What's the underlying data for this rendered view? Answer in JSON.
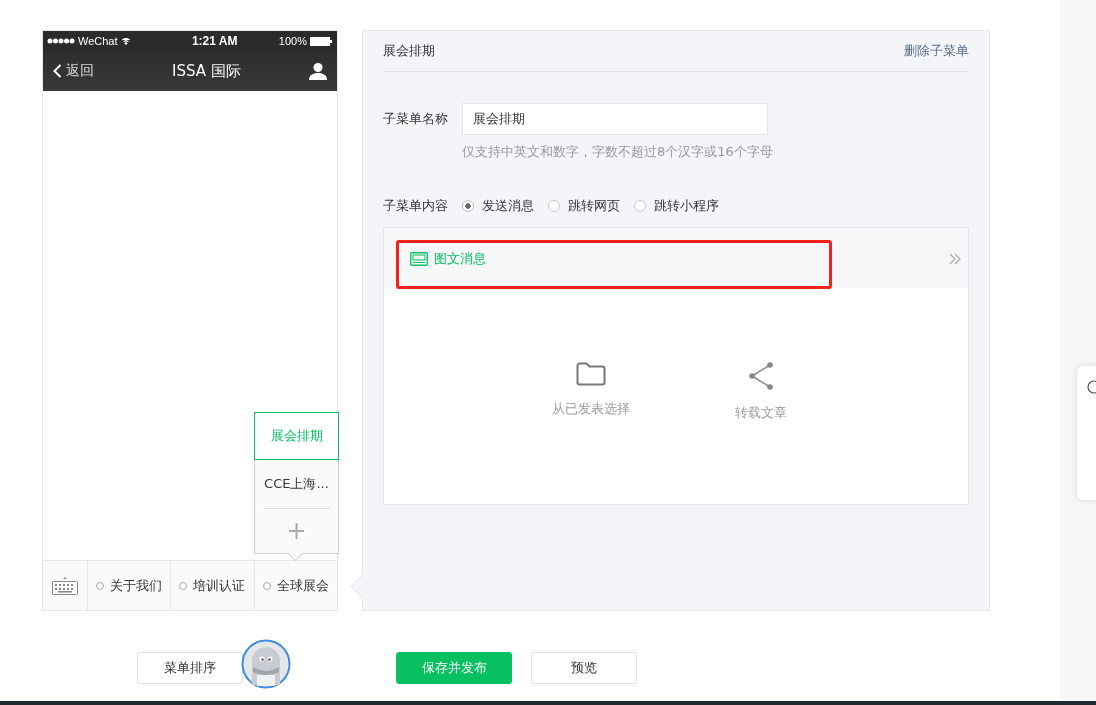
{
  "phone": {
    "status": {
      "carrier": "WeChat",
      "time": "1:21 AM",
      "battery": "100%"
    },
    "nav": {
      "back": "返回",
      "title": "ISSA 国际"
    },
    "submenu": [
      {
        "label": "展会排期",
        "selected": true
      },
      {
        "label": "CCE上海...",
        "selected": false
      }
    ],
    "add": "+",
    "menu": [
      "关于我们",
      "培训认证",
      "全球展会"
    ]
  },
  "editor": {
    "title": "展会排期",
    "delete": "删除子菜单",
    "name_label": "子菜单名称",
    "name_value": "展会排期",
    "hint": "仅支持中英文和数字，字数不超过8个汉字或16个字母",
    "content_label": "子菜单内容",
    "options": [
      {
        "label": "发送消息",
        "selected": true
      },
      {
        "label": "跳转网页",
        "selected": false
      },
      {
        "label": "跳转小程序",
        "selected": false
      }
    ],
    "message_tabs": [
      {
        "label": "图文消息",
        "selected": true
      }
    ],
    "actions": [
      {
        "label": "从已发表选择",
        "kind": "folder"
      },
      {
        "label": "转载文章",
        "kind": "share"
      }
    ]
  },
  "footer": {
    "sort": "菜单排序",
    "publish": "保存并发布",
    "preview": "预览"
  }
}
